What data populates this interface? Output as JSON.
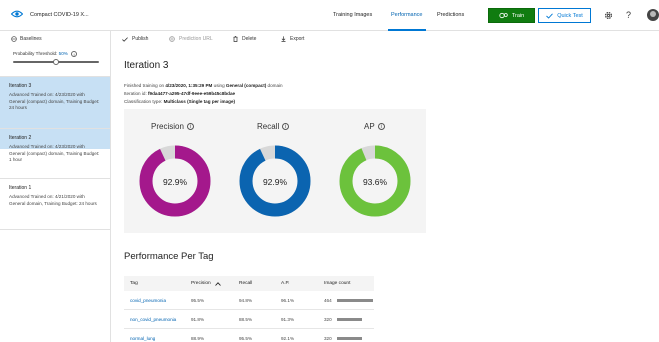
{
  "topbar": {
    "project_name": "Compact COVID-19 X...",
    "tabs": [
      {
        "label": "Training Images",
        "active": false
      },
      {
        "label": "Performance",
        "active": true
      },
      {
        "label": "Predictions",
        "active": false
      }
    ],
    "train_label": "Train",
    "quick_test_label": "Quick Test",
    "help_glyph": "?"
  },
  "sidebar": {
    "baselines_label": "Baselines",
    "threshold_label": "Probability Threshold:",
    "threshold_value": "50%",
    "threshold_fraction": 0.5,
    "iterations": [
      {
        "title": "Iteration 3",
        "desc": "Advanced Trained on: 4/23/2020 with General (compact) domain, Training Budget: 24 hours",
        "selected": true
      },
      {
        "title": "Iteration 2",
        "desc": "Advanced Trained on: 4/23/2020 with General (compact) domain, Training Budget: 1 hour",
        "selected": false
      },
      {
        "title": "Iteration 1",
        "desc": "Advanced Trained on: 4/21/2020 with General domain, Training Budget: 24 hours",
        "selected": false
      }
    ]
  },
  "toolbar": {
    "publish": "Publish",
    "prediction_url": "Prediction URL",
    "delete": "Delete",
    "export": "Export"
  },
  "main": {
    "iteration_title": "Iteration 3",
    "finished_prefix": "Finished training on ",
    "finished_date": "4/23/2020, 1:35:29 PM",
    "finished_mid": " using ",
    "finished_domain": "General (compact)",
    "finished_suffix": " domain",
    "iteration_id_prefix": "Iteration id: ",
    "iteration_id": "f9da4477-a295-47df-9eee-e59b45c8bdae",
    "classification_prefix": "Classification type: ",
    "classification_type": "Multiclass (Single tag per image)",
    "metrics": [
      {
        "label": "Precision",
        "value": "92.9%",
        "fraction": 0.929,
        "color": "#a4188c"
      },
      {
        "label": "Recall",
        "value": "92.9%",
        "fraction": 0.929,
        "color": "#0b64b0"
      },
      {
        "label": "AP",
        "value": "93.6%",
        "fraction": 0.936,
        "color": "#6cc23c"
      }
    ],
    "ring_track_color": "#d8d8d8",
    "per_tag_title": "Performance Per Tag",
    "table": {
      "headers": [
        "Tag",
        "Precision",
        "Recall",
        "A.P.",
        "Image count"
      ],
      "rows": [
        {
          "tag": "covid_pneumonia",
          "precision": "95.5%",
          "recall": "94.8%",
          "ap": "96.1%",
          "count": "464",
          "count_value": 464
        },
        {
          "tag": "non_covid_pneumonia",
          "precision": "91.8%",
          "recall": "88.5%",
          "ap": "91.3%",
          "count": "320",
          "count_value": 320
        },
        {
          "tag": "normal_lung",
          "precision": "88.9%",
          "recall": "95.5%",
          "ap": "92.1%",
          "count": "320",
          "count_value": 320
        }
      ]
    }
  }
}
